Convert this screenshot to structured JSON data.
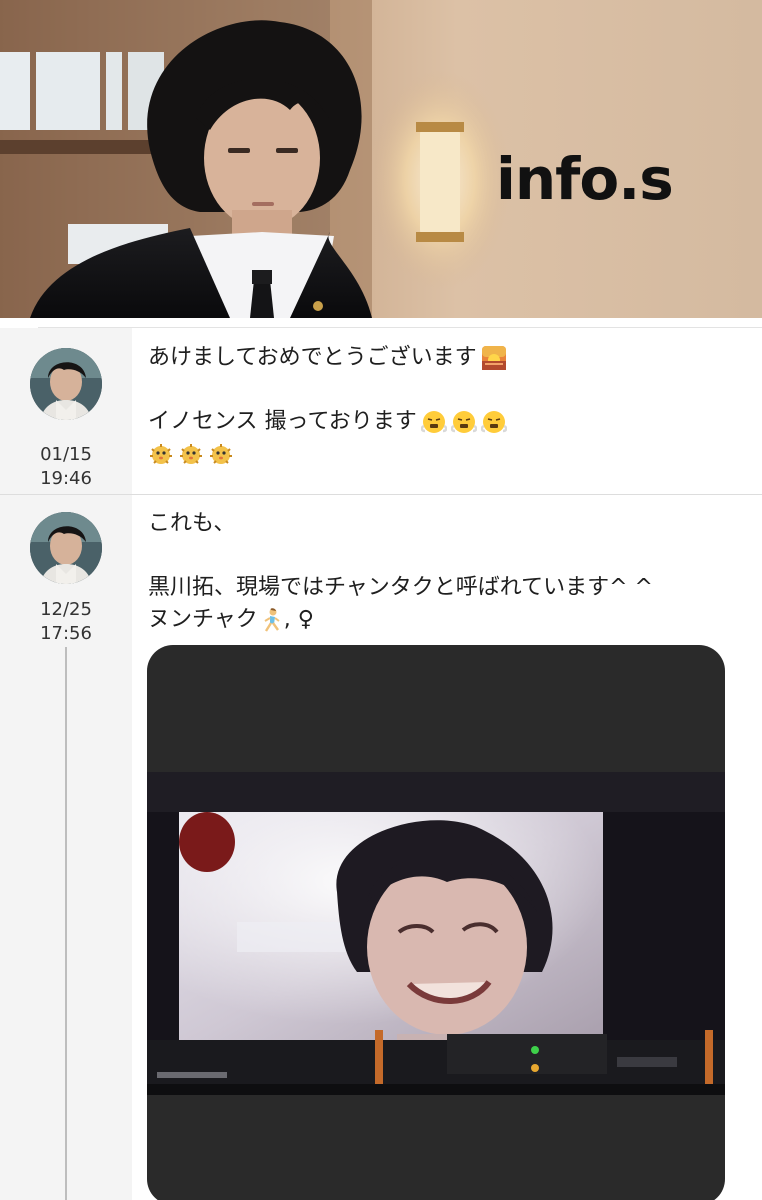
{
  "header": {
    "title": "info.s"
  },
  "posts": [
    {
      "avatar_icon": "profile-avatar",
      "date": "01/15",
      "time": "19:46",
      "lines": [
        "あけましておめでとうございます",
        "",
        "イノセンス 撮っております",
        ""
      ],
      "emoji": {
        "line1": "sunrise-emoji",
        "line3": "steaming-face-emoji x3",
        "line4": "blowfish-emoji x3"
      }
    },
    {
      "avatar_icon": "profile-avatar",
      "date": "12/25",
      "time": "17:56",
      "lines": [
        "これも、",
        "",
        "黒川拓、現場ではチャンタクと呼ばれています^ ^",
        "ヌンチャク",
        ", ♀"
      ],
      "emoji": {
        "line4": "woman-running-emoji"
      },
      "media_icon": "attached-photo"
    }
  ]
}
